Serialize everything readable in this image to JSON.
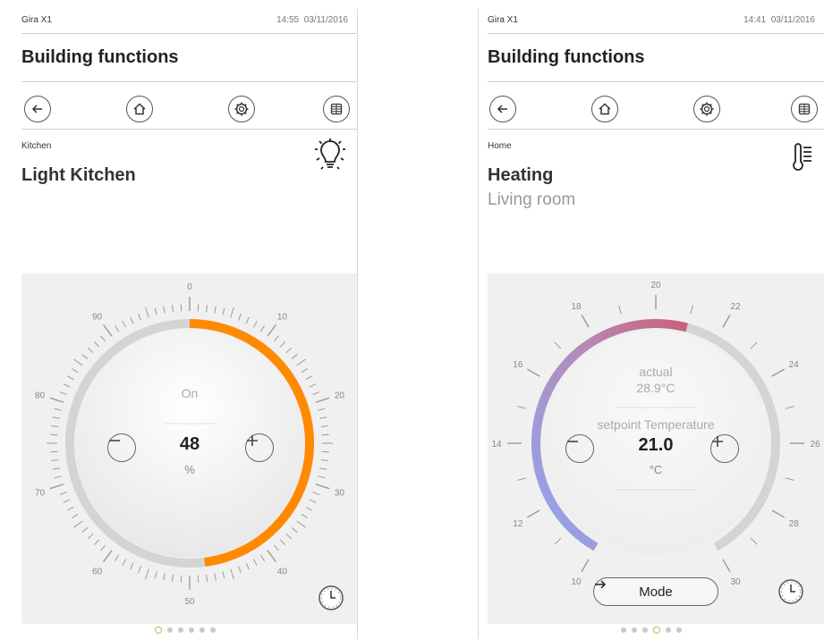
{
  "colors": {
    "accent_orange": "#ff8a00",
    "ring_grey": "#d4d4d4",
    "active_dot": "#a6c84a",
    "heat_blue": "#8fa6f0",
    "heat_red": "#c9607a"
  },
  "left": {
    "device": "Gira X1",
    "time": "14:55",
    "date": "03/11/2016",
    "title": "Building functions",
    "room": "Kitchen",
    "function_name": "Light Kitchen",
    "function_icon": "light-bulb-icon",
    "state_label": "On",
    "value": "48",
    "unit": "%",
    "level_fraction": 0.48,
    "scale_labels": [
      "0",
      "10",
      "20",
      "30",
      "40",
      "50",
      "60",
      "70",
      "80",
      "90"
    ],
    "pages_total": 6,
    "page_active": 1
  },
  "right": {
    "device": "Gira X1",
    "time": "14:41",
    "date": "03/11/2016",
    "title": "Building functions",
    "room": "Home",
    "function_name": "Heating",
    "function_sub": "Living room",
    "function_icon": "thermometer-icon",
    "actual_label": "actual",
    "actual_value": "28.9°C",
    "setpoint_label": "setpoint Temperature",
    "setpoint_value": "21.0",
    "unit": "°C",
    "scale_labels": [
      "10",
      "12",
      "14",
      "16",
      "18",
      "20",
      "22",
      "24",
      "26",
      "28",
      "30"
    ],
    "scale_min": 10,
    "scale_max": 30,
    "mode_label": "Mode",
    "pages_total": 6,
    "page_active": 4
  },
  "nav_icons": [
    "back-arrow-icon",
    "home-icon",
    "settings-gear-icon",
    "grid-icon"
  ]
}
